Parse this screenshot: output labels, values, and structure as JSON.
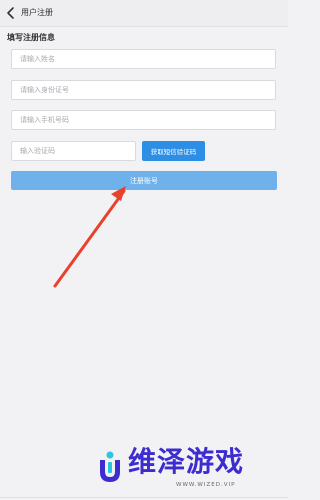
{
  "nav": {
    "title": "用户注册"
  },
  "form": {
    "section_title": "填写注册信息",
    "name_placeholder": "请输入姓名",
    "id_placeholder": "请输入身份证号",
    "phone_placeholder": "请输入手机号码",
    "code_placeholder": "输入验证码",
    "sms_button_label": "获取短信验证码",
    "register_button_label": "注册账号"
  },
  "colors": {
    "primary": "#2d8ee6",
    "register_button": "#6fb1ea",
    "annotation_arrow": "#e8412c",
    "brand": "#3d2ccf"
  },
  "annotation": {
    "icon": "red-arrow-icon"
  },
  "watermark": {
    "brand_name": "维泽游戏",
    "url": "WWW.WIZED.VIP"
  }
}
